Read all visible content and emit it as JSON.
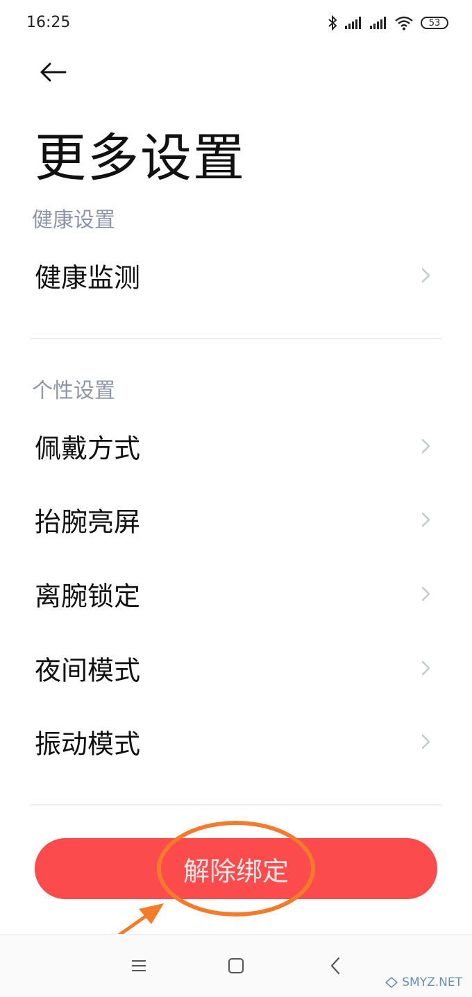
{
  "status_bar": {
    "time": "16:25",
    "battery": "53",
    "icons": [
      "bluetooth-icon",
      "signal-icon",
      "signal-icon",
      "wifi-icon",
      "battery-icon"
    ]
  },
  "header": {
    "back_icon": "arrow-left-icon",
    "title": "更多设置"
  },
  "sections": [
    {
      "header": "健康设置",
      "items": [
        {
          "label": "健康监测"
        }
      ]
    },
    {
      "header": "个性设置",
      "items": [
        {
          "label": "佩戴方式"
        },
        {
          "label": "抬腕亮屏"
        },
        {
          "label": "离腕锁定"
        },
        {
          "label": "夜间模式"
        },
        {
          "label": "振动模式"
        }
      ]
    }
  ],
  "actions": {
    "unbind_label": "解除绑定"
  },
  "nav_bar": {
    "icons": [
      "menu-icon",
      "home-square-icon",
      "back-chevron-icon"
    ]
  },
  "watermark": {
    "text": "SMYZ.NET"
  },
  "colors": {
    "accent_red": "#fb4b4d",
    "annotation_orange": "#f47b2a",
    "section_gray": "#8d96a8"
  }
}
